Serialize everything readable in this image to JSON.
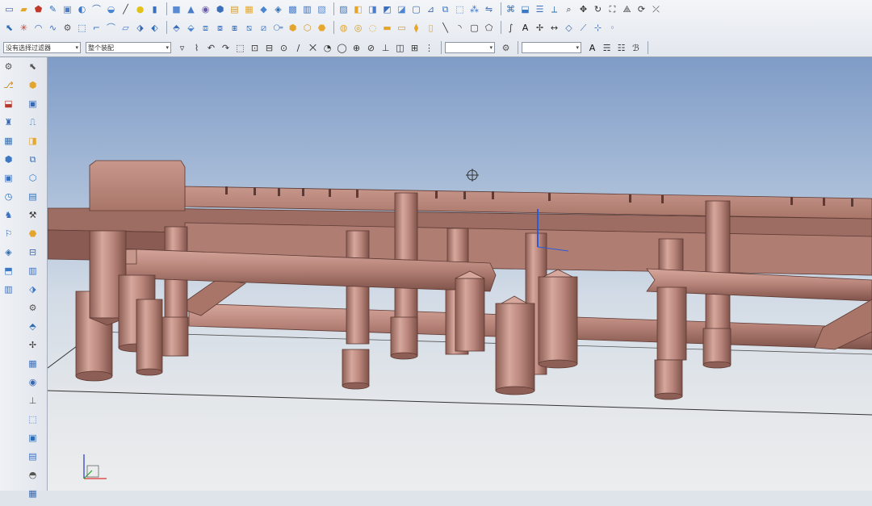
{
  "toolbar": {
    "rows": [
      {
        "id": "r1",
        "icons": [
          {
            "name": "new-file-icon",
            "glyph": "▭",
            "color": "#3a5fa8"
          },
          {
            "name": "open-folder-icon",
            "glyph": "▰",
            "color": "#e4a52c"
          },
          {
            "name": "shield-icon",
            "glyph": "⬟",
            "color": "#c0392b"
          },
          {
            "name": "sketch-icon",
            "glyph": "✎",
            "color": "#2e6db4"
          },
          {
            "name": "extrude-icon",
            "glyph": "▣",
            "color": "#4a7cc9"
          },
          {
            "name": "revolve-icon",
            "glyph": "◐",
            "color": "#3c78c4"
          },
          {
            "name": "sweep-icon",
            "glyph": "⌒",
            "color": "#3a68b0"
          },
          {
            "name": "blend-icon",
            "glyph": "◒",
            "color": "#4b86d0"
          },
          {
            "name": "line-icon",
            "glyph": "╱",
            "color": "#333"
          },
          {
            "name": "sphere-icon",
            "glyph": "●",
            "color": "#e2c21a"
          },
          {
            "name": "cylinder-icon",
            "glyph": "▮",
            "color": "#3a6fbe"
          },
          {
            "name": "block-icon",
            "glyph": "■",
            "color": "#5a8ad1"
          },
          {
            "name": "cone-icon",
            "glyph": "▲",
            "color": "#4a7cc9"
          },
          {
            "name": "hole-icon",
            "glyph": "◉",
            "color": "#6a5aa8"
          },
          {
            "name": "boss-icon",
            "glyph": "⬢",
            "color": "#3a6fbe"
          },
          {
            "name": "pocket-icon",
            "glyph": "▤",
            "color": "#d19a2a"
          },
          {
            "name": "pad-icon",
            "glyph": "▦",
            "color": "#e7a72c"
          },
          {
            "name": "slot-icon",
            "glyph": "◆",
            "color": "#4b86d0"
          },
          {
            "name": "groove-icon",
            "glyph": "◈",
            "color": "#2e6db4"
          },
          {
            "name": "thread-icon",
            "glyph": "▩",
            "color": "#4a7cc9"
          },
          {
            "name": "unite-icon",
            "glyph": "▥",
            "color": "#3a68b0"
          },
          {
            "name": "subtract-icon",
            "glyph": "▧",
            "color": "#5a8ad1"
          },
          {
            "name": "intersect-icon",
            "glyph": "▨",
            "color": "#3c78c4"
          },
          {
            "name": "trim-body-icon",
            "glyph": "◧",
            "color": "#e4a52c"
          },
          {
            "name": "split-body-icon",
            "glyph": "◨",
            "color": "#4a7cc9"
          },
          {
            "name": "edge-blend-icon",
            "glyph": "◩",
            "color": "#3a6fbe"
          },
          {
            "name": "chamfer-icon",
            "glyph": "◪",
            "color": "#4b86d0"
          },
          {
            "name": "shell-icon",
            "glyph": "▢",
            "color": "#2e6db4"
          },
          {
            "name": "draft-icon",
            "glyph": "⊿",
            "color": "#3a68b0"
          },
          {
            "name": "offset-face-icon",
            "glyph": "⧉",
            "color": "#3c78c4"
          },
          {
            "name": "scale-body-icon",
            "glyph": "⬚",
            "color": "#4a7cc9"
          },
          {
            "name": "pattern-icon",
            "glyph": "⁂",
            "color": "#3a6fbe"
          },
          {
            "name": "mirror-icon",
            "glyph": "⇋",
            "color": "#3a68b0"
          },
          {
            "name": "sew-icon",
            "glyph": "⌘",
            "color": "#2e6db4"
          },
          {
            "name": "patch-icon",
            "glyph": "⬓",
            "color": "#3c78c4"
          },
          {
            "name": "layer-icon",
            "glyph": "☰",
            "color": "#3a6fbe"
          },
          {
            "name": "measure-icon",
            "glyph": "⟂",
            "color": "#2e6db4"
          },
          {
            "name": "zoom-icon",
            "glyph": "⌕",
            "color": "#333"
          },
          {
            "name": "pan-icon",
            "glyph": "✥",
            "color": "#333"
          },
          {
            "name": "rotate-icon",
            "glyph": "↻",
            "color": "#333"
          },
          {
            "name": "fit-icon",
            "glyph": "⛶",
            "color": "#333"
          },
          {
            "name": "perspective-icon",
            "glyph": "⟁",
            "color": "#333"
          },
          {
            "name": "refresh-icon",
            "glyph": "⟳",
            "color": "#333"
          },
          {
            "name": "wcs-icon",
            "glyph": "⤫",
            "color": "#333"
          }
        ]
      },
      {
        "id": "r2",
        "icons": [
          {
            "name": "select-icon",
            "glyph": "⬉",
            "color": "#2e6db4"
          },
          {
            "name": "snap-point-icon",
            "glyph": "✳",
            "color": "#c0392b"
          },
          {
            "name": "arc-icon",
            "glyph": "◠",
            "color": "#3a68b0"
          },
          {
            "name": "curve-icon",
            "glyph": "∿",
            "color": "#3a6fbe"
          },
          {
            "name": "wrench-icon",
            "glyph": "⚙",
            "color": "#555"
          },
          {
            "name": "select-all-icon",
            "glyph": "⬚",
            "color": "#2e6db4"
          },
          {
            "name": "fillet-icon",
            "glyph": "⌐",
            "color": "#3a6fbe"
          },
          {
            "name": "tangent-icon",
            "glyph": "⌒",
            "color": "#3c78c4"
          },
          {
            "name": "face-icon",
            "glyph": "▱",
            "color": "#4a7cc9"
          },
          {
            "name": "replace-face-icon",
            "glyph": "⬗",
            "color": "#3a68b0"
          },
          {
            "name": "move-face-icon",
            "glyph": "⬖",
            "color": "#2e6db4"
          },
          {
            "name": "resize-face-icon",
            "glyph": "⬘",
            "color": "#3a6fbe"
          },
          {
            "name": "delete-face-icon",
            "glyph": "⬙",
            "color": "#4b86d0"
          },
          {
            "name": "offset-region-icon",
            "glyph": "⧈",
            "color": "#3c78c4"
          },
          {
            "name": "pull-face-icon",
            "glyph": "⧇",
            "color": "#4a7cc9"
          },
          {
            "name": "pattern-face-icon",
            "glyph": "⧆",
            "color": "#3a68b0"
          },
          {
            "name": "copy-face-icon",
            "glyph": "⧅",
            "color": "#2e6db4"
          },
          {
            "name": "cut-face-icon",
            "glyph": "⧄",
            "color": "#3a6fbe"
          },
          {
            "name": "paste-face-icon",
            "glyph": "⧃",
            "color": "#3c78c4"
          },
          {
            "name": "shade-icon",
            "glyph": "⬢",
            "color": "#e4a52c"
          },
          {
            "name": "wireframe-icon",
            "glyph": "⬡",
            "color": "#d19a2a"
          },
          {
            "name": "hidden-line-icon",
            "glyph": "⬣",
            "color": "#e7a72c"
          },
          {
            "name": "studio-icon",
            "glyph": "◍",
            "color": "#e4a52c"
          },
          {
            "name": "face-analysis-icon",
            "glyph": "◎",
            "color": "#d19a2a"
          },
          {
            "name": "partial-shade-icon",
            "glyph": "◌",
            "color": "#e7a72c"
          },
          {
            "name": "front-view-icon",
            "glyph": "▬",
            "color": "#e4a52c"
          },
          {
            "name": "top-view-icon",
            "glyph": "▭",
            "color": "#d19a2a"
          },
          {
            "name": "iso-view-icon",
            "glyph": "⧫",
            "color": "#e7a72c"
          },
          {
            "name": "right-view-icon",
            "glyph": "▯",
            "color": "#e4a52c"
          },
          {
            "name": "line-tool-icon",
            "glyph": "╲",
            "color": "#333"
          },
          {
            "name": "arc-tool-icon",
            "glyph": "◝",
            "color": "#333"
          },
          {
            "name": "rectangle-icon",
            "glyph": "▢",
            "color": "#333"
          },
          {
            "name": "polygon-icon",
            "glyph": "⬠",
            "color": "#333"
          },
          {
            "name": "spline-icon",
            "glyph": "∫",
            "color": "#333"
          },
          {
            "name": "text-tool-icon",
            "glyph": "A",
            "color": "#111"
          },
          {
            "name": "point-tool-icon",
            "glyph": "✢",
            "color": "#333"
          },
          {
            "name": "dimension-icon",
            "glyph": "↔",
            "color": "#333"
          },
          {
            "name": "datum-plane-icon",
            "glyph": "◇",
            "color": "#3a68b0"
          },
          {
            "name": "datum-axis-icon",
            "glyph": "⟋",
            "color": "#3a68b0"
          },
          {
            "name": "datum-csys-icon",
            "glyph": "⊹",
            "color": "#3a68b0"
          },
          {
            "name": "datum-point-icon",
            "glyph": "◦",
            "color": "#3a68b0"
          }
        ]
      },
      {
        "id": "r3",
        "items": [
          {
            "kind": "combo",
            "name": "selection-filter-dropdown",
            "text": "没有选择过滤器",
            "width": 96
          },
          {
            "kind": "combo",
            "name": "selection-scope-dropdown",
            "text": "整个装配",
            "width": 106
          },
          {
            "kind": "icons",
            "icons": [
              {
                "name": "filter-icon",
                "glyph": "▿",
                "color": "#333"
              },
              {
                "name": "curve-rule-icon",
                "glyph": "⌇",
                "color": "#333"
              },
              {
                "name": "undo-icon",
                "glyph": "↶",
                "color": "#333"
              },
              {
                "name": "redo-icon",
                "glyph": "↷",
                "color": "#333"
              },
              {
                "name": "box-select-icon",
                "glyph": "⬚",
                "color": "#333"
              },
              {
                "name": "snap-end-icon",
                "glyph": "⊡",
                "color": "#333"
              },
              {
                "name": "snap-mid-icon",
                "glyph": "⊟",
                "color": "#333"
              },
              {
                "name": "snap-center-icon",
                "glyph": "⊙",
                "color": "#333"
              },
              {
                "name": "snap-on-curve-icon",
                "glyph": "∕",
                "color": "#333"
              },
              {
                "name": "snap-intersect-icon",
                "glyph": "⨉",
                "color": "#333"
              },
              {
                "name": "snap-quadrant-icon",
                "glyph": "◔",
                "color": "#333"
              },
              {
                "name": "snap-existing-icon",
                "glyph": "◯",
                "color": "#333"
              },
              {
                "name": "snap-arc-center-icon",
                "glyph": "⊕",
                "color": "#333"
              },
              {
                "name": "snap-tangent-icon",
                "glyph": "⊘",
                "color": "#333"
              },
              {
                "name": "snap-perp-icon",
                "glyph": "⊥",
                "color": "#333"
              },
              {
                "name": "snap-face-icon",
                "glyph": "◫",
                "color": "#333"
              },
              {
                "name": "snap-bounded-icon",
                "glyph": "⊞",
                "color": "#333"
              },
              {
                "name": "snap-grid-icon",
                "glyph": "⋮",
                "color": "#333"
              }
            ]
          },
          {
            "kind": "combo",
            "name": "selection-option-dropdown",
            "text": "",
            "width": 62
          },
          {
            "kind": "icons",
            "icons": [
              {
                "name": "prefs-icon",
                "glyph": "⚙",
                "color": "#555"
              }
            ]
          },
          {
            "kind": "combo",
            "name": "color-filter-dropdown",
            "text": "",
            "width": 74
          },
          {
            "kind": "icons",
            "icons": [
              {
                "name": "text-a-icon",
                "glyph": "A",
                "color": "#111"
              },
              {
                "name": "text-style-icon",
                "glyph": "☴",
                "color": "#333"
              },
              {
                "name": "text-align-icon",
                "glyph": "☷",
                "color": "#333"
              },
              {
                "name": "text-bold-icon",
                "glyph": "ℬ",
                "color": "#333"
              }
            ]
          }
        ]
      }
    ]
  },
  "left_toolbar": {
    "col1": [
      {
        "name": "assembly-nav-icon",
        "glyph": "⚙",
        "color": "#555"
      },
      {
        "name": "constraint-nav-icon",
        "glyph": "⎇",
        "color": "#c98a1c"
      },
      {
        "name": "part-nav-icon",
        "glyph": "⬓",
        "color": "#b53a2d"
      },
      {
        "name": "reuse-library-icon",
        "glyph": "♜",
        "color": "#3a68b0"
      },
      {
        "name": "web-browser-icon",
        "glyph": "▦",
        "color": "#2e6db4"
      },
      {
        "name": "history-icon",
        "glyph": "⬢",
        "color": "#3c78c4"
      },
      {
        "name": "system-materials-icon",
        "glyph": "▣",
        "color": "#3a6fbe"
      },
      {
        "name": "process-studio-icon",
        "glyph": "◷",
        "color": "#2e6db4"
      },
      {
        "name": "roles-icon",
        "glyph": "♞",
        "color": "#3a6fbe"
      },
      {
        "name": "system-scene-icon",
        "glyph": "⚐",
        "color": "#3a68b0"
      },
      {
        "name": "analysis-icon",
        "glyph": "◈",
        "color": "#2e6db4"
      },
      {
        "name": "visualization-icon",
        "glyph": "⬒",
        "color": "#3c78c4"
      },
      {
        "name": "information-icon",
        "glyph": "▥",
        "color": "#3a6fbe"
      }
    ],
    "col2": [
      {
        "name": "mold-wizard-init-icon",
        "glyph": "⬉",
        "color": "#555"
      },
      {
        "name": "mold-csys-icon",
        "glyph": "⬢",
        "color": "#e4a52c"
      },
      {
        "name": "shrink-icon",
        "glyph": "▣",
        "color": "#3a68b0"
      },
      {
        "name": "workpiece-icon",
        "glyph": "⎍",
        "color": "#2e6db4"
      },
      {
        "name": "cavity-layout-icon",
        "glyph": "◨",
        "color": "#e7a72c"
      },
      {
        "name": "family-mold-icon",
        "glyph": "⧉",
        "color": "#3a6fbe"
      },
      {
        "name": "tool-icon",
        "glyph": "⬡",
        "color": "#3c78c4"
      },
      {
        "name": "parting-icon",
        "glyph": "▤",
        "color": "#2e6db4"
      },
      {
        "name": "moldbase-icon",
        "glyph": "⚒",
        "color": "#333"
      },
      {
        "name": "standard-part-icon",
        "glyph": "⬣",
        "color": "#e4a52c"
      },
      {
        "name": "ejector-icon",
        "glyph": "⊟",
        "color": "#3a68b0"
      },
      {
        "name": "trim-ejector-icon",
        "glyph": "▥",
        "color": "#3a6fbe"
      },
      {
        "name": "slider-lifter-icon",
        "glyph": "⬗",
        "color": "#3c78c4"
      },
      {
        "name": "sub-insert-icon",
        "glyph": "⚙",
        "color": "#555"
      },
      {
        "name": "gate-icon",
        "glyph": "⬘",
        "color": "#2e6db4"
      },
      {
        "name": "runner-icon",
        "glyph": "✢",
        "color": "#333"
      },
      {
        "name": "cooling-icon",
        "glyph": "▦",
        "color": "#3a6fbe"
      },
      {
        "name": "electrode-icon",
        "glyph": "◉",
        "color": "#3a68b0"
      },
      {
        "name": "trim-mold-icon",
        "glyph": "⊥",
        "color": "#555"
      },
      {
        "name": "pocket-mold-icon",
        "glyph": "⬚",
        "color": "#3c78c4"
      },
      {
        "name": "material-list-icon",
        "glyph": "▣",
        "color": "#2e6db4"
      },
      {
        "name": "drawing-icon",
        "glyph": "▤",
        "color": "#3a6fbe"
      },
      {
        "name": "cast-process-icon",
        "glyph": "◓",
        "color": "#555"
      },
      {
        "name": "view-manager-icon",
        "glyph": "▦",
        "color": "#3a68b0"
      }
    ]
  },
  "viewport": {
    "part_color": "#b9857b",
    "part_shadow": "#8d5e55",
    "part_highlight": "#d6a79c",
    "sky_top": "#7f9cc7",
    "floor": "#ecedee",
    "datum_axis_color": "#2a5cd8",
    "triad_colors": {
      "x": "#d33",
      "y": "#2a2",
      "z": "#23c"
    }
  }
}
